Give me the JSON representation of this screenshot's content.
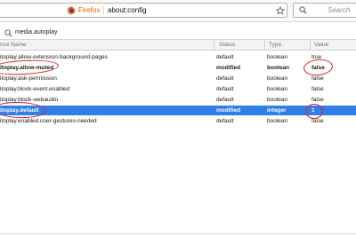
{
  "browser": {
    "brand_label": "Firefox",
    "url": "about:config",
    "search_placeholder": "Search"
  },
  "filter": {
    "value": "media.autoplay"
  },
  "table": {
    "columns": [
      "Preference Name",
      "Status",
      "Type",
      "Value"
    ],
    "columns_visible": [
      "nce Name",
      "Status",
      "Type",
      "Value"
    ],
    "rows": [
      {
        "name": "itoplay.allow-extension-background-pages",
        "status": "default",
        "type": "boolean",
        "value": "true",
        "modified": false,
        "selected": false
      },
      {
        "name": "itoplay.allow-muted",
        "status": "modified",
        "type": "boolean",
        "value": "false",
        "modified": true,
        "selected": false
      },
      {
        "name": "itoplay.ask-permission",
        "status": "default",
        "type": "boolean",
        "value": "false",
        "modified": false,
        "selected": false
      },
      {
        "name": "itoplay.block-event.enabled",
        "status": "default",
        "type": "boolean",
        "value": "false",
        "modified": false,
        "selected": false
      },
      {
        "name": "itoplay.block-webaudio",
        "status": "default",
        "type": "boolean",
        "value": "false",
        "modified": false,
        "selected": false
      },
      {
        "name": "itoplay.default",
        "status": "modified",
        "type": "integer",
        "value": "1",
        "modified": true,
        "selected": true
      },
      {
        "name": "itoplay.enabled.user-gestures-needed",
        "status": "default",
        "type": "boolean",
        "value": "false",
        "modified": false,
        "selected": false
      }
    ]
  },
  "colors": {
    "selection": "#2f7ee9",
    "annotation": "#e0202a",
    "firefox_label": "#e66000"
  },
  "icons": [
    "firefox-logo-icon",
    "star-icon",
    "search-icon",
    "filter-search-icon"
  ]
}
